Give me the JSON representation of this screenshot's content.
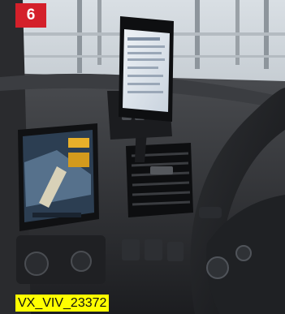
{
  "badge": {
    "number": "6",
    "color": "#d4202a"
  },
  "caption": {
    "text": "VX_VIV_23372",
    "highlight_color": "#ffff00"
  },
  "scene": {
    "subject": "smartphone-in-dashboard-cradle",
    "elements": [
      "window",
      "phone",
      "cradle",
      "air-vent",
      "steering-wheel",
      "infotainment-screen",
      "dashboard-buttons"
    ]
  }
}
